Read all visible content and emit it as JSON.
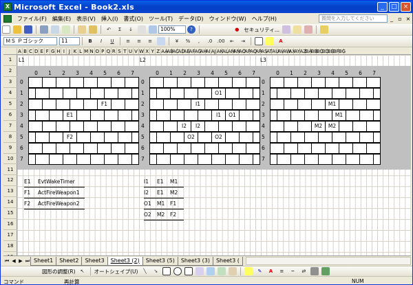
{
  "window": {
    "title": "Microsoft Excel - Book2.xls",
    "min": "_",
    "max": "□",
    "close": "×"
  },
  "menu": {
    "items": [
      "ファイル(F)",
      "編集(E)",
      "表示(V)",
      "挿入(I)",
      "書式(O)",
      "ツール(T)",
      "データ(D)",
      "ウィンドウ(W)",
      "ヘルプ(H)"
    ],
    "help_placeholder": "質問を入力してください",
    "doc_min": "_",
    "doc_max": "▫",
    "doc_close": "×"
  },
  "toolbar1": {
    "zoom": "100%",
    "security": "セキュリティ...",
    "sum": "Σ"
  },
  "toolbar2": {
    "font": "ＭＳ Ｐゴシック",
    "size": "11",
    "bold": "B",
    "italic": "I",
    "underline": "U"
  },
  "columns": [
    "A",
    "B",
    "C",
    "D",
    "E",
    "F",
    "G",
    "H",
    "I",
    "J",
    "K",
    "L",
    "M",
    "N",
    "O",
    "P",
    "Q",
    "R",
    "S",
    "T",
    "U",
    "V",
    "W",
    "X",
    "Y",
    "Z",
    "AA",
    "AB",
    "AC",
    "AD",
    "AE",
    "AF",
    "AG",
    "AH",
    "AI",
    "AJ",
    "AK",
    "AL",
    "AM",
    "AN",
    "AO",
    "AP",
    "AQ",
    "AR",
    "AS",
    "AT",
    "AU",
    "AV",
    "AW",
    "AX",
    "AY",
    "AZ",
    "BA",
    "BB",
    "BC",
    "BD",
    "BE",
    "BF",
    "BG"
  ],
  "rows": [
    "1",
    "2",
    "3",
    "4",
    "5",
    "6",
    "7",
    "8",
    "9",
    "10",
    "11",
    "12",
    "13",
    "14",
    "15",
    "16",
    "17",
    "18",
    "19"
  ],
  "panels": [
    {
      "label": "L1",
      "headers": [
        "0",
        "1",
        "2",
        "3",
        "4",
        "5",
        "6",
        "7"
      ],
      "row_labels": [
        "0",
        "1",
        "2",
        "3",
        "4",
        "5",
        "6",
        "7"
      ],
      "cells": [
        {
          "row": 2,
          "col": 5,
          "text": "F1"
        },
        {
          "row": 3,
          "col": 2,
          "text": "E1"
        },
        {
          "row": 5,
          "col": 2,
          "text": "F2"
        }
      ]
    },
    {
      "label": "L2",
      "headers": [
        "0",
        "1",
        "2",
        "3",
        "4",
        "5",
        "6",
        "7"
      ],
      "row_labels": [
        "0",
        "1",
        "2",
        "3",
        "4",
        "5",
        "6",
        "7"
      ],
      "cells": [
        {
          "row": 1,
          "col": 4,
          "text": "O1"
        },
        {
          "row": 2,
          "col": 3,
          "text": "I1"
        },
        {
          "row": 3,
          "col": 4,
          "text": "I1"
        },
        {
          "row": 3,
          "col": 5,
          "text": "O1"
        },
        {
          "row": 4,
          "col": 2,
          "text": "I2"
        },
        {
          "row": 4,
          "col": 3,
          "text": "I2"
        },
        {
          "row": 5,
          "col": 2,
          "text": "O2"
        },
        {
          "row": 5,
          "col": 4,
          "text": "O2"
        }
      ]
    },
    {
      "label": "L3",
      "headers": [
        "0",
        "1",
        "2",
        "3",
        "4",
        "5",
        "6",
        "7"
      ],
      "row_labels": [
        "0",
        "1",
        "2",
        "3",
        "4",
        "5",
        "6",
        "7"
      ],
      "cells": [
        {
          "row": 2,
          "col": 4,
          "text": "M1"
        },
        {
          "row": 3,
          "col": 4,
          "text": "M1"
        },
        {
          "row": 4,
          "col": 3,
          "text": "M2"
        },
        {
          "row": 4,
          "col": 4,
          "text": "M2"
        }
      ]
    }
  ],
  "events": [
    [
      "E1",
      "EvtWakeTimer"
    ],
    [
      "F1",
      "ActFireWeapon1"
    ],
    [
      "F2",
      "ActFireWeapon2"
    ]
  ],
  "links": [
    [
      "I1",
      "E1",
      "M1"
    ],
    [
      "I2",
      "E1",
      "M2"
    ],
    [
      "O1",
      "M1",
      "F1"
    ],
    [
      "O2",
      "M2",
      "F2"
    ]
  ],
  "sheet_tabs": [
    "Sheet1",
    "Sheet2",
    "Sheet3",
    "Sheet3 (2)",
    "Sheet3 (5)",
    "Sheet3 (3)",
    "Sheet3 ("
  ],
  "active_tab": 3,
  "draw_toolbar": {
    "draw": "図形の調整(R)",
    "autoshape": "オートシェイプ(U)"
  },
  "status": {
    "left": "コマンド",
    "mid": "再計算",
    "right": "NUM"
  }
}
